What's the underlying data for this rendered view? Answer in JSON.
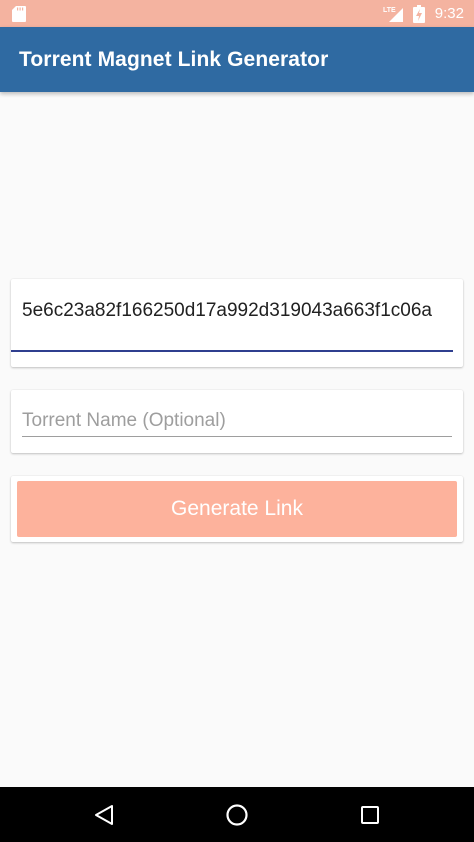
{
  "status_bar": {
    "network_label": "LTE",
    "time": "9:32"
  },
  "icons": {
    "sd": "sd-card-icon",
    "signal": "lte-signal-icon",
    "battery": "battery-charging-icon",
    "back": "back-triangle-icon",
    "home": "home-circle-icon",
    "recents": "recents-square-icon"
  },
  "app_bar": {
    "title": "Torrent Magnet Link Generator"
  },
  "form": {
    "hash_value": "5e6c23a82f166250d17a992d319043a663f1c06a",
    "name_placeholder": "Torrent Name (Optional)",
    "name_value": "",
    "generate_label": "Generate Link"
  },
  "colors": {
    "status_bar": "#f4b3a0",
    "app_bar": "#2f6aa2",
    "button": "#fdb29c",
    "focused_underline": "#2f3f8f"
  }
}
